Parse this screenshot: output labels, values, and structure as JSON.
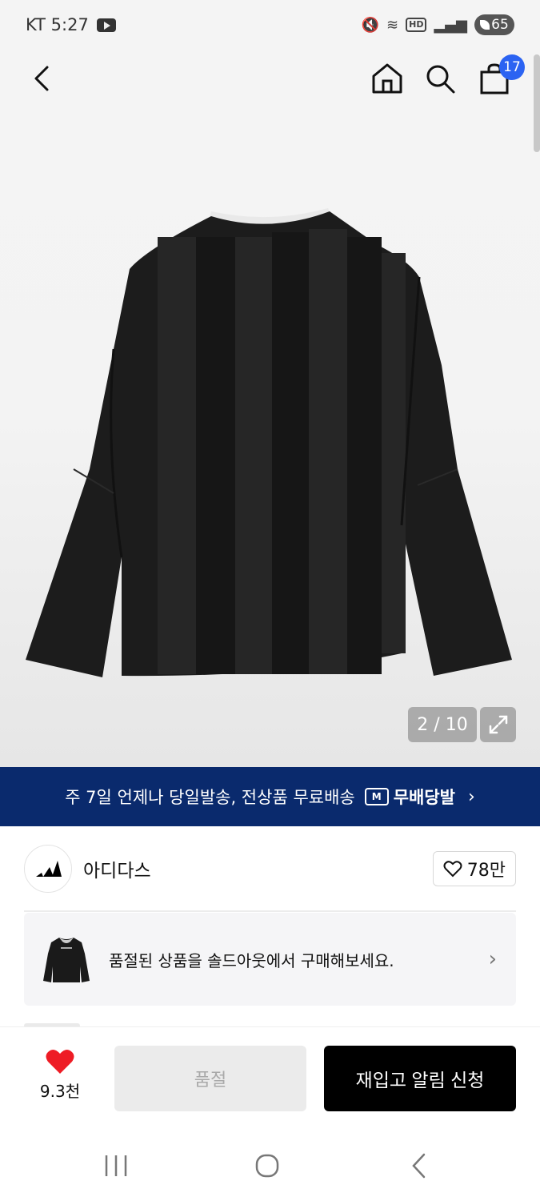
{
  "status_bar": {
    "carrier_time": "KT 5:27",
    "hd_label": "HD",
    "battery": "65"
  },
  "nav": {
    "cart_count": "17"
  },
  "gallery": {
    "counter": "2 / 10"
  },
  "banner": {
    "text": "주 7일 언제나 당일발송, 전상품 무료배송",
    "badge_text": "무배당발",
    "truck_label": "M"
  },
  "brand": {
    "name": "아디다스",
    "likes": "78만"
  },
  "soldout_card": {
    "text": "품절된 상품을 솔드아웃에서 구매해보세요."
  },
  "actions": {
    "wish_count": "9.3천",
    "soldout_label": "품절",
    "restock_label": "재입고 알림 신청"
  },
  "colors": {
    "banner_bg": "#0a2a6d",
    "badge_blue": "#2b63f2",
    "heart_red": "#ee1c25"
  }
}
